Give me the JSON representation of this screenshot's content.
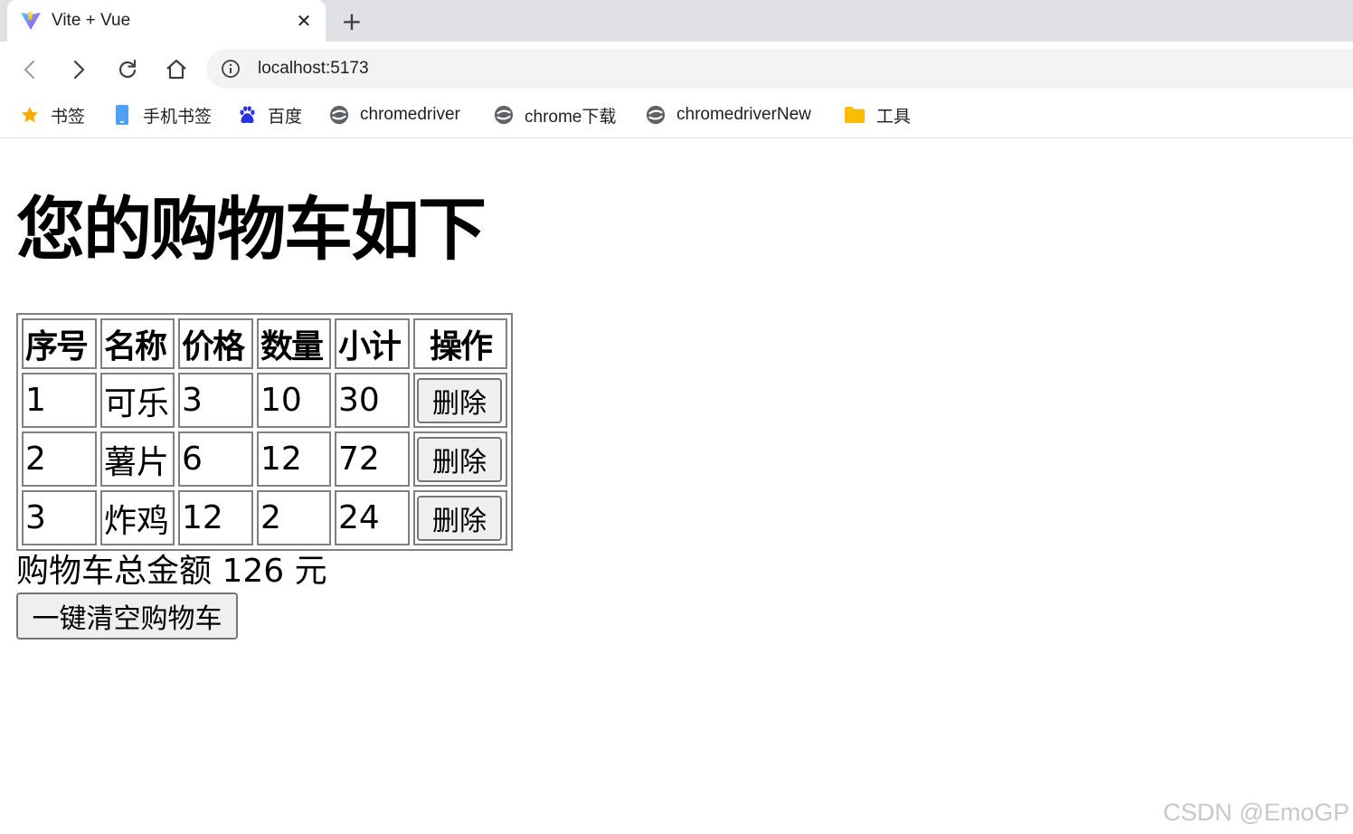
{
  "browser": {
    "tab": {
      "title": "Vite + Vue",
      "favicon": "vite-logo-icon",
      "close_glyph": "✕"
    },
    "new_tab_glyph": "+",
    "address_bar": {
      "url": "localhost:5173"
    },
    "bookmarks": [
      {
        "label": "书签",
        "icon": "star-icon",
        "color": "#f9ab00"
      },
      {
        "label": "手机书签",
        "icon": "mobile-icon",
        "color": "#4285f4"
      },
      {
        "label": "百度",
        "icon": "baidu-paw-icon",
        "color": "#2932e1"
      },
      {
        "label": "chromedriver",
        "icon": "chromedriver-icon",
        "color": "#5f6368"
      },
      {
        "label": "chrome下载",
        "icon": "chromedriver-icon",
        "color": "#5f6368"
      },
      {
        "label": "chromedriverNew",
        "icon": "chromedriver-icon",
        "color": "#5f6368"
      },
      {
        "label": "工具",
        "icon": "folder-icon",
        "color": "#fbbc04"
      }
    ]
  },
  "page": {
    "title": "您的购物车如下",
    "table": {
      "headers": [
        "序号",
        "名称",
        "价格",
        "数量",
        "小计",
        "操作"
      ],
      "rows": [
        {
          "id": "1",
          "name": "可乐",
          "price": "3",
          "qty": "10",
          "subtotal": "30",
          "action": "删除"
        },
        {
          "id": "2",
          "name": "薯片",
          "price": "6",
          "qty": "12",
          "subtotal": "72",
          "action": "删除"
        },
        {
          "id": "3",
          "name": "炸鸡",
          "price": "12",
          "qty": "2",
          "subtotal": "24",
          "action": "删除"
        }
      ]
    },
    "total_text": "购物车总金额 126 元",
    "clear_button": "一键清空购物车"
  },
  "watermark": "CSDN @EmoGP"
}
